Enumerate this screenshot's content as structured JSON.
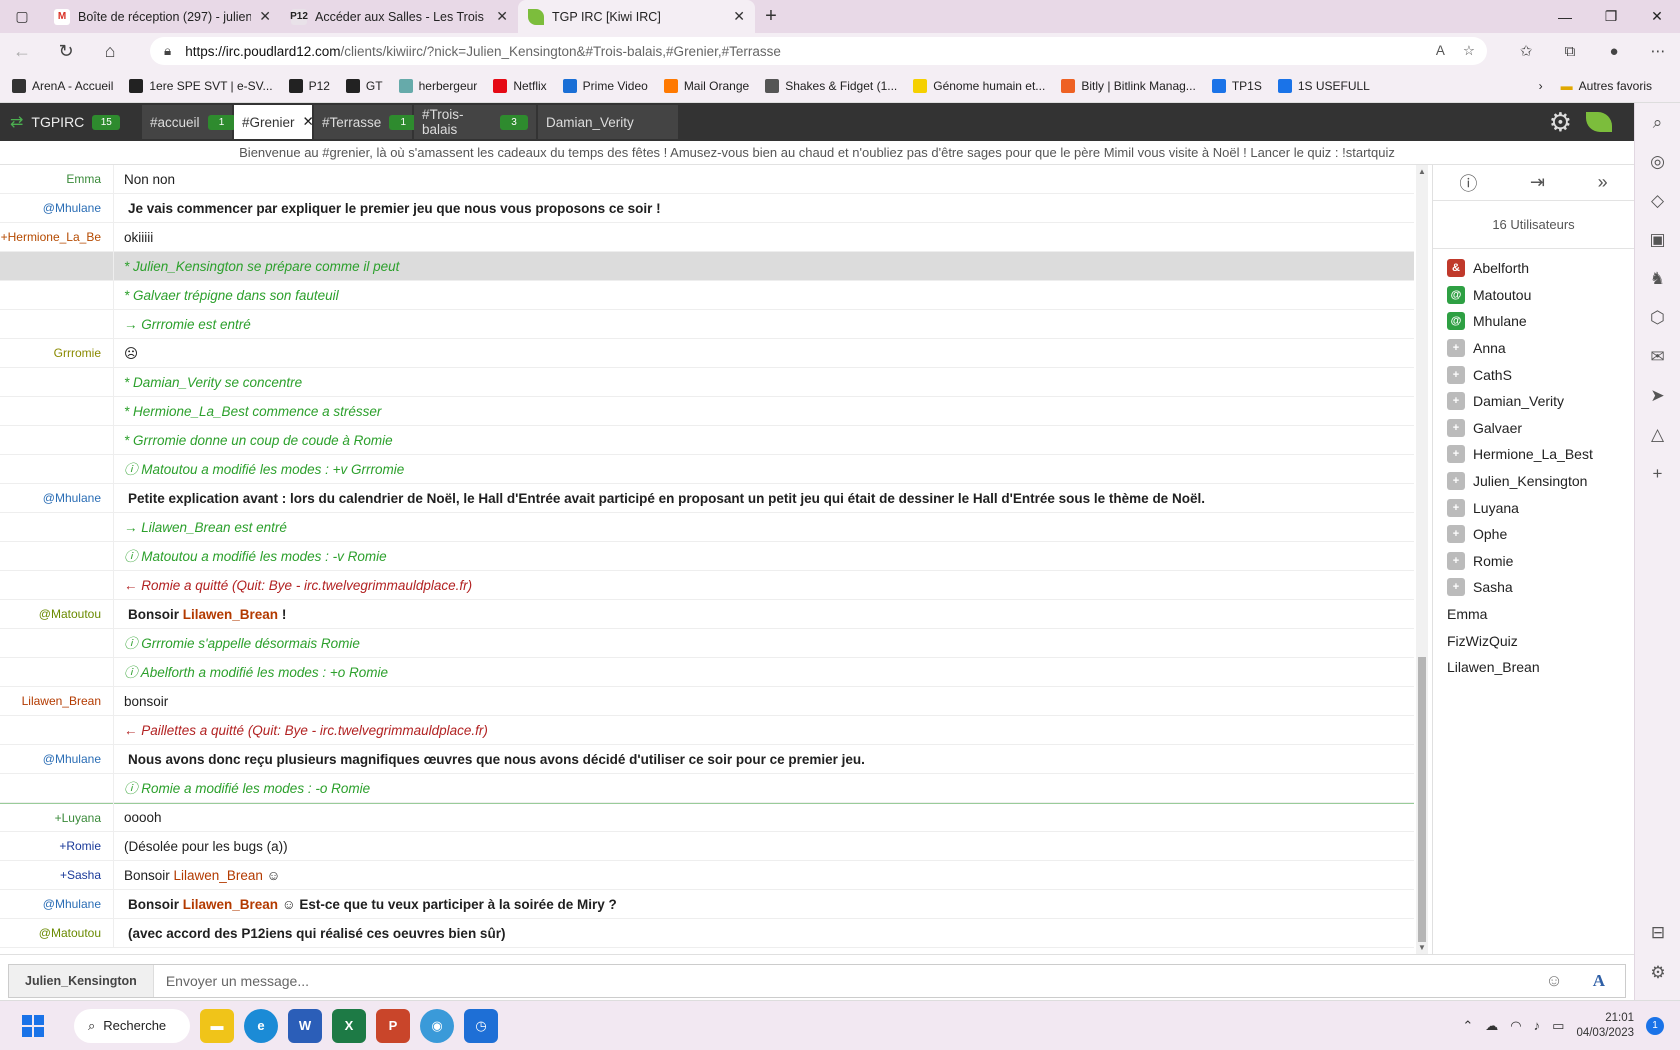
{
  "browser": {
    "tabs": [
      {
        "title": "Boîte de réception (297) - julien.",
        "icon": "gmail-icon",
        "active": false
      },
      {
        "title": "Accéder aux Salles - Les Trois Bal",
        "icon": "p12-icon",
        "active": false
      },
      {
        "title": "TGP IRC [Kiwi IRC]",
        "icon": "leaf-icon",
        "active": true
      }
    ],
    "url_host": "https://irc.poudlard12.com",
    "url_path": "/clients/kiwiirc/?nick=Julien_Kensington&#Trois-balais,#Grenier,#Terrasse",
    "bookmarks": [
      "ArenA - Accueil",
      "1ere SPE SVT | e-SV...",
      "P12",
      "GT",
      "herbergeur",
      "Netflix",
      "Prime Video",
      "Mail Orange",
      "Shakes & Fidget (1...",
      "Génome humain et...",
      "Bitly | Bitlink Manag...",
      "TP1S",
      "1S USEFULL"
    ],
    "bookmark_labels": {
      "p12_1": "P12",
      "p12_2": "GT"
    },
    "other_favorites": "Autres favoris"
  },
  "kiwi": {
    "server": {
      "label": "TGPIRC",
      "count": "15"
    },
    "channels": [
      {
        "label": "#accueil",
        "count": "1"
      },
      {
        "label": "#Grenier",
        "active": true
      },
      {
        "label": "#Terrasse",
        "count": "1"
      },
      {
        "label": "#Trois-balais",
        "count": "3"
      },
      {
        "label": "Damian_Verity"
      }
    ],
    "topic": "Bienvenue au #grenier, là où s'amassent les cadeaux du temps des fêtes ! Amusez-vous bien au chaud et n'oubliez pas d'être sages pour que le père Mimil vous visite à Noël ! Lancer le quiz : !startquiz",
    "messages": [
      {
        "nick": "Emma",
        "nick_color": "#3a8a3a",
        "text": "Non non",
        "style": "normal"
      },
      {
        "nick": "@Mhulane",
        "nick_color": "#2a6db5",
        "text": "Je vais commencer par expliquer le premier jeu que nous vous proposons ce soir !",
        "style": "bold"
      },
      {
        "nick": "+Hermione_La_Be",
        "nick_color": "#b54a00",
        "text": "okiiiii",
        "style": "normal"
      },
      {
        "nick": "",
        "nick_color": "#333",
        "text": "* Julien_Kensington se prépare comme il peut",
        "style": "act",
        "highlight": true
      },
      {
        "nick": "",
        "nick_color": "#333",
        "text": "* Galvaer trépigne dans son fauteuil",
        "style": "act"
      },
      {
        "nick": "",
        "nick_color": "#333",
        "text": "→ Grrromie est entré",
        "style": "join"
      },
      {
        "nick": "Grrromie",
        "nick_color": "#8a8a00",
        "text": "☹",
        "style": "normal"
      },
      {
        "nick": "",
        "nick_color": "#333",
        "text": "* Damian_Verity se concentre",
        "style": "act"
      },
      {
        "nick": "",
        "nick_color": "#333",
        "text": "* Hermione_La_Best commence a strésser",
        "style": "act"
      },
      {
        "nick": "",
        "nick_color": "#333",
        "text": "* Grrromie donne un coup de coude à Romie",
        "style": "act"
      },
      {
        "nick": "",
        "nick_color": "#333",
        "text": "ⓘ Matoutou a modifié les modes : +v Grrromie",
        "style": "mode"
      },
      {
        "nick": "@Mhulane",
        "nick_color": "#2a6db5",
        "text": "Petite explication avant : lors du calendrier de Noël, le Hall d'Entrée avait participé en proposant un petit jeu qui était de dessiner le Hall d'Entrée sous le thème de Noël.",
        "style": "bold"
      },
      {
        "nick": "",
        "nick_color": "#333",
        "text": "→ Lilawen_Brean est entré",
        "style": "join"
      },
      {
        "nick": "",
        "nick_color": "#333",
        "text": "ⓘ Matoutou a modifié les modes : -v Romie",
        "style": "mode"
      },
      {
        "nick": "",
        "nick_color": "#333",
        "text": "← Romie a quitté (Quit: Bye - irc.twelvegrimmauldplace.fr)",
        "style": "quit"
      },
      {
        "nick": "@Matoutou",
        "nick_color": "#6a8a00",
        "text_before": "Bonsoir ",
        "hl": "Lilawen_Brean",
        "text_after": " !",
        "style": "bold"
      },
      {
        "nick": "",
        "nick_color": "#333",
        "text": "ⓘ Grrromie s'appelle désormais Romie",
        "style": "mode"
      },
      {
        "nick": "",
        "nick_color": "#333",
        "text": "ⓘ Abelforth a modifié les modes : +o Romie",
        "style": "mode"
      },
      {
        "nick": "Lilawen_Brean",
        "nick_color": "#b33a00",
        "text": "bonsoir",
        "style": "normal"
      },
      {
        "nick": "",
        "nick_color": "#333",
        "text": "← Paillettes a quitté (Quit: Bye - irc.twelvegrimmauldplace.fr)",
        "style": "quit"
      },
      {
        "nick": "@Mhulane",
        "nick_color": "#2a6db5",
        "text": "Nous avons donc reçu plusieurs magnifiques œuvres que nous avons décidé d'utiliser ce soir pour ce premier jeu.",
        "style": "bold"
      },
      {
        "nick": "",
        "nick_color": "#333",
        "text": "ⓘ Romie a modifié les modes : -o Romie",
        "style": "mode"
      },
      {
        "nick": "+Luyana",
        "nick_color": "#3a8a3a",
        "text": "ooooh",
        "style": "normal",
        "separator": true
      },
      {
        "nick": "+Romie",
        "nick_color": "#1a3a9a",
        "text": "(Désolée pour les bugs (a))",
        "style": "normal"
      },
      {
        "nick": "+Sasha",
        "nick_color": "#1a3a9a",
        "text_before": "Bonsoir ",
        "hl": "Lilawen_Brean",
        "text_after": " ☺",
        "style": "normal"
      },
      {
        "nick": "@Mhulane",
        "nick_color": "#2a6db5",
        "text_before": "Bonsoir ",
        "hl": "Lilawen_Brean",
        "text_after": " ☺  Est-ce que tu veux participer à la soirée de Miry ?",
        "style": "bold"
      },
      {
        "nick": "@Matoutou",
        "nick_color": "#6a8a00",
        "text": "(avec accord des P12iens qui réalisé ces oeuvres bien sûr)",
        "style": "bold"
      }
    ],
    "user_count": "16 Utilisateurs",
    "users": [
      {
        "badge": "&",
        "kind": "a",
        "name": "Abelforth"
      },
      {
        "badge": "@",
        "kind": "o",
        "name": "Matoutou"
      },
      {
        "badge": "@",
        "kind": "o",
        "name": "Mhulane"
      },
      {
        "badge": "+",
        "kind": "v",
        "name": "Anna"
      },
      {
        "badge": "+",
        "kind": "v",
        "name": "CathS"
      },
      {
        "badge": "+",
        "kind": "v",
        "name": "Damian_Verity"
      },
      {
        "badge": "+",
        "kind": "v",
        "name": "Galvaer"
      },
      {
        "badge": "+",
        "kind": "v",
        "name": "Hermione_La_Best"
      },
      {
        "badge": "+",
        "kind": "v",
        "name": "Julien_Kensington"
      },
      {
        "badge": "+",
        "kind": "v",
        "name": "Luyana"
      },
      {
        "badge": "+",
        "kind": "v",
        "name": "Ophe"
      },
      {
        "badge": "+",
        "kind": "v",
        "name": "Romie"
      },
      {
        "badge": "+",
        "kind": "v",
        "name": "Sasha"
      },
      {
        "badge": "",
        "kind": "",
        "name": "Emma"
      },
      {
        "badge": "",
        "kind": "",
        "name": "FizWizQuiz"
      },
      {
        "badge": "",
        "kind": "",
        "name": "Lilawen_Brean"
      }
    ],
    "input": {
      "nick": "Julien_Kensington",
      "placeholder": "Envoyer un message..."
    }
  },
  "taskbar": {
    "search": "Recherche",
    "time": "21:01",
    "date": "04/03/2023",
    "notifications": "1"
  }
}
